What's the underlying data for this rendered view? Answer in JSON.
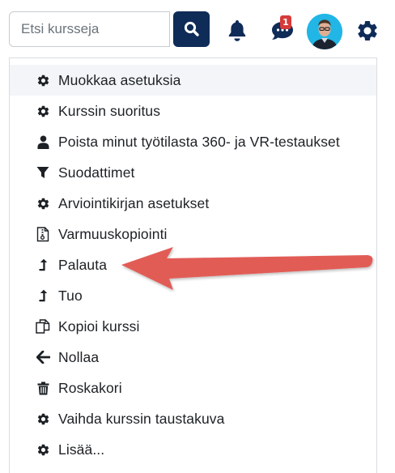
{
  "search": {
    "placeholder": "Etsi kursseja"
  },
  "notifications": {
    "chat_badge": "1"
  },
  "menu": {
    "items": [
      {
        "label": "Muokkaa asetuksia",
        "icon": "gear-icon"
      },
      {
        "label": "Kurssin suoritus",
        "icon": "gear-icon"
      },
      {
        "label": "Poista minut työtilasta 360- ja VR-testaukset",
        "icon": "user-icon"
      },
      {
        "label": "Suodattimet",
        "icon": "filter-icon"
      },
      {
        "label": "Arviointikirjan asetukset",
        "icon": "gear-icon"
      },
      {
        "label": "Varmuuskopiointi",
        "icon": "file-zip-icon"
      },
      {
        "label": "Palauta",
        "icon": "level-up-icon"
      },
      {
        "label": "Tuo",
        "icon": "level-up-icon"
      },
      {
        "label": "Kopioi kurssi",
        "icon": "copy-icon"
      },
      {
        "label": "Nollaa",
        "icon": "arrow-left-icon"
      },
      {
        "label": "Roskakori",
        "icon": "trash-icon"
      },
      {
        "label": "Vaihda kurssin taustakuva",
        "icon": "gear-icon"
      },
      {
        "label": "Lisää...",
        "icon": "gear-icon"
      }
    ]
  },
  "colors": {
    "brand": "#0f2b57",
    "annotation_arrow": "#e25c57",
    "badge": "#d63a3a"
  }
}
